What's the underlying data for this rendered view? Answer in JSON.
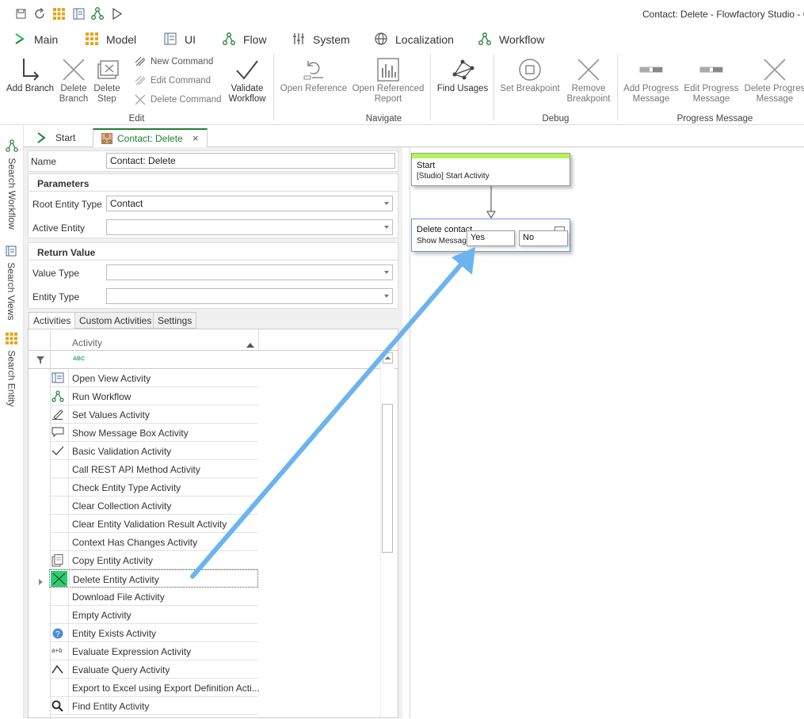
{
  "window": {
    "title": "Contact: Delete  - Flowfactory Studio - C"
  },
  "quickaccess": {
    "icons": [
      "save-icon",
      "refresh-icon",
      "grid-icon",
      "form-icon",
      "workflow-icon",
      "play-icon"
    ]
  },
  "main_tabs": [
    {
      "label": "Main"
    },
    {
      "label": "Model"
    },
    {
      "label": "UI"
    },
    {
      "label": "Flow"
    },
    {
      "label": "System"
    },
    {
      "label": "Localization"
    },
    {
      "label": "Workflow"
    }
  ],
  "ribbon": {
    "edit": {
      "group_label": "Edit",
      "add_branch": "Add Branch",
      "delete_branch": "Delete Branch",
      "delete_step": "Delete Step",
      "new_command": "New Command",
      "edit_command": "Edit Command",
      "delete_command": "Delete Command",
      "validate_workflow": "Validate Workflow"
    },
    "navigate": {
      "group_label": "Navigate",
      "open_reference": "Open Reference",
      "open_referenced_report": "Open Referenced Report",
      "find_usages": "Find Usages"
    },
    "debug": {
      "group_label": "Debug",
      "set_breakpoint": "Set Breakpoint",
      "remove_breakpoint": "Remove Breakpoint"
    },
    "progress": {
      "group_label": "Progress Message",
      "add_progress": "Add Progress Message",
      "edit_progress": "Edit Progress Message",
      "delete_progress": "Delete Progres Message"
    }
  },
  "left_sidebar": {
    "search_workflow": "Search Workflow",
    "search_views": "Search Views",
    "search_entity": "Search Entity"
  },
  "doc_tabs": [
    {
      "label": "Start"
    },
    {
      "label": "Contact: Delete",
      "close": "×"
    }
  ],
  "properties": {
    "name_label": "Name",
    "name_value": "Contact: Delete",
    "parameters_header": "Parameters",
    "root_entity_type_label": "Root Entity Type",
    "root_entity_type_value": "Contact",
    "active_entity_label": "Active Entity",
    "active_entity_value": "",
    "return_value_header": "Return Value",
    "value_type_label": "Value Type",
    "value_type_value": "",
    "entity_type_label": "Entity Type",
    "entity_type_value": ""
  },
  "lower_tabs": [
    {
      "label": "Activities"
    },
    {
      "label": "Custom Activities"
    },
    {
      "label": "Settings"
    }
  ],
  "grid": {
    "column_header": "Activity",
    "filter_icon_text": "ABC",
    "rows": [
      {
        "label": "Open View Activity",
        "icon": "view-icon"
      },
      {
        "label": "Run Workflow",
        "icon": "workflow-icon"
      },
      {
        "label": "Set Values Activity",
        "icon": "pencil-icon"
      },
      {
        "label": "Show Message Box  Activity",
        "icon": "speech-bubble-icon"
      },
      {
        "label": "Basic Validation Activity",
        "icon": "checkmark-icon"
      },
      {
        "label": "Call REST API Method Activity",
        "icon": ""
      },
      {
        "label": "Check Entity Type Activity",
        "icon": ""
      },
      {
        "label": "Clear Collection Activity",
        "icon": ""
      },
      {
        "label": "Clear Entity Validation Result Activity",
        "icon": ""
      },
      {
        "label": "Context Has Changes Activity",
        "icon": ""
      },
      {
        "label": "Copy Entity Activity",
        "icon": "copy-icon"
      },
      {
        "label": "Delete Entity Activity",
        "icon": "delete-x-icon"
      },
      {
        "label": "Download File Activity",
        "icon": ""
      },
      {
        "label": "Empty Activity",
        "icon": ""
      },
      {
        "label": "Entity Exists Activity",
        "icon": "question-icon"
      },
      {
        "label": "Evaluate Expression Activity",
        "icon": "a+b-icon"
      },
      {
        "label": "Evaluate Query Activity",
        "icon": "query-icon"
      },
      {
        "label": "Export to Excel using Export Definition Acti...",
        "icon": ""
      },
      {
        "label": "Find Entity Activity",
        "icon": "magnifier-icon"
      }
    ],
    "expr_icon_text": "a+b"
  },
  "canvas": {
    "start_node": {
      "title": "Start",
      "subtitle": "[Studio] Start Activity"
    },
    "delete_node": {
      "title": "Delete contact",
      "subtitle": "Show Message"
    },
    "yes_option": "Yes",
    "no_option": "No"
  },
  "colors": {
    "accent": "#1e7e34",
    "start_bar": "#b5f25a",
    "arrow": "#6cb4ee",
    "selected_icon_bg": "#2ecc71"
  }
}
